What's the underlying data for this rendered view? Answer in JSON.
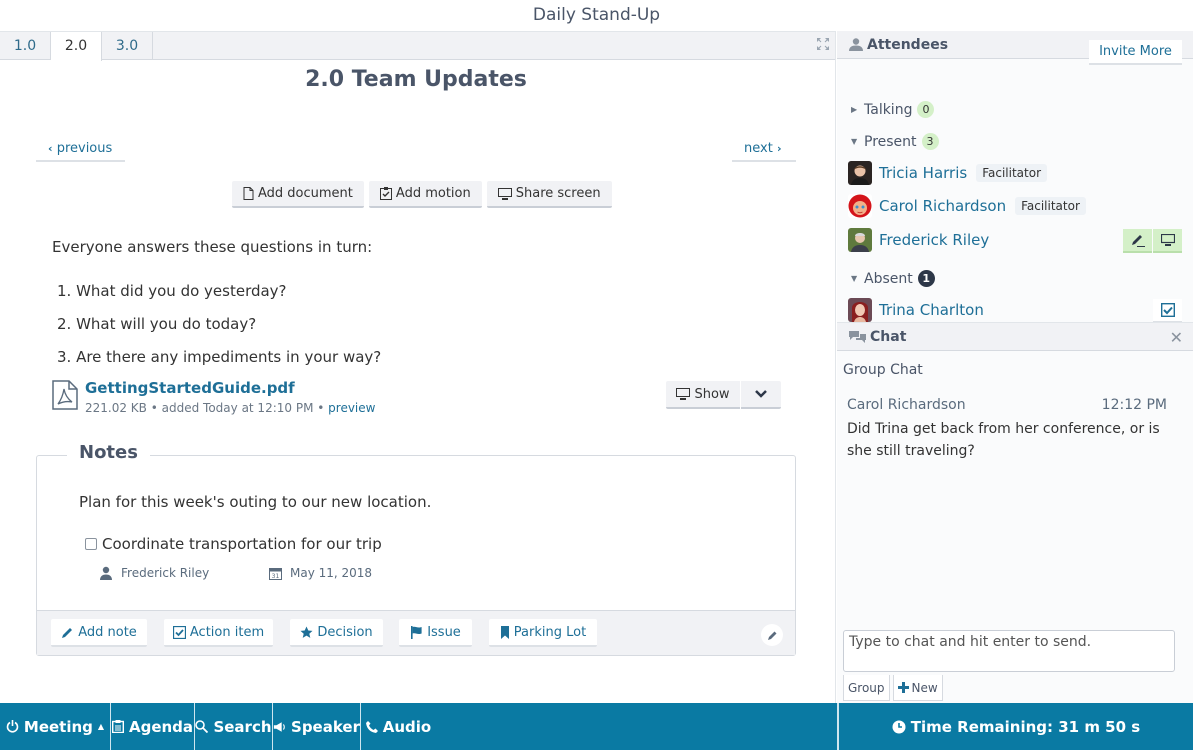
{
  "window_title": "Daily Stand-Up",
  "tabs": [
    {
      "label": "1.0",
      "active": false
    },
    {
      "label": "2.0",
      "active": true
    },
    {
      "label": "3.0",
      "active": false
    }
  ],
  "agenda_item": {
    "title": "2.0 Team Updates",
    "previous_label": "previous",
    "next_label": "next",
    "actions": {
      "add_document": "Add document",
      "add_motion": "Add motion",
      "share_screen": "Share screen"
    },
    "intro": "Everyone answers these questions in turn:",
    "questions": [
      "1. What did you do yesterday?",
      "2. What will you do today?",
      "3. Are there any impediments in your way?"
    ],
    "attachment": {
      "name": "GettingStartedGuide.pdf",
      "size": "221.02 KB",
      "added": "added Today at 12:10 PM",
      "separator": "•",
      "preview_label": "preview",
      "show_label": "Show"
    }
  },
  "notes": {
    "heading": "Notes",
    "text": "Plan for this week's outing to our new location.",
    "task": {
      "label": "Coordinate transportation for our trip",
      "checked": false,
      "assignee": "Frederick Riley",
      "due": "May 11, 2018"
    },
    "buttons": {
      "add_note": "Add note",
      "action_item": "Action item",
      "decision": "Decision",
      "issue": "Issue",
      "parking_lot": "Parking Lot"
    }
  },
  "attendees": {
    "title": "Attendees",
    "invite_label": "Invite More",
    "groups": {
      "talking": {
        "label": "Talking",
        "count": "0"
      },
      "present": {
        "label": "Present",
        "count": "3"
      },
      "absent": {
        "label": "Absent",
        "count": "1"
      }
    },
    "present": [
      {
        "name": "Tricia Harris",
        "badge": "Facilitator"
      },
      {
        "name": "Carol Richardson",
        "badge": "Facilitator"
      },
      {
        "name": "Frederick Riley",
        "badge": ""
      }
    ],
    "absent": [
      {
        "name": "Trina Charlton"
      }
    ]
  },
  "chat": {
    "title": "Chat",
    "group_title": "Group Chat",
    "messages": [
      {
        "author": "Carol Richardson",
        "time": "12:12 PM",
        "text": "Did Trina get back from her conference, or is she still traveling?"
      }
    ],
    "input_placeholder": "Type to chat and hit enter to send.",
    "tabs": {
      "group": "Group",
      "new": "New"
    }
  },
  "bottom_bar": {
    "meeting": "Meeting",
    "agenda": "Agenda",
    "search": "Search",
    "speaker": "Speaker",
    "audio": "Audio",
    "time_remaining": "Time Remaining: 31 m 50 s"
  },
  "colors": {
    "accent": "#0a7aa3",
    "link": "#1e6f97",
    "success_bg": "#d4f0c8"
  }
}
